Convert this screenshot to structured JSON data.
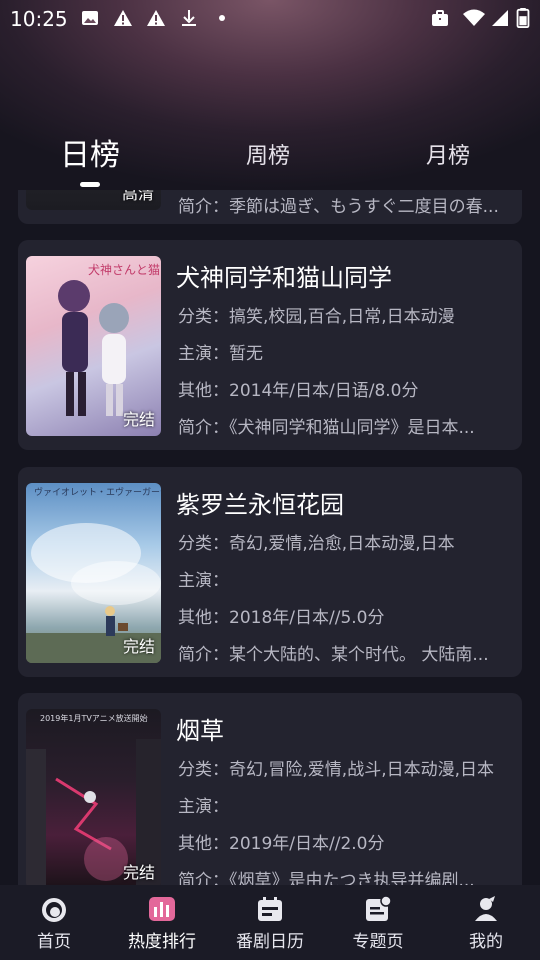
{
  "status_bar": {
    "time": "10:25",
    "left_icons": [
      "image-icon",
      "warning-icon",
      "warning-icon",
      "download-icon",
      "dot-icon"
    ],
    "right_icons": [
      "briefcase-icon",
      "wifi-icon",
      "signal-icon",
      "battery-icon"
    ]
  },
  "tabs": [
    {
      "label": "日榜",
      "active": true
    },
    {
      "label": "周榜",
      "active": false
    },
    {
      "label": "月榜",
      "active": false
    }
  ],
  "partial_card": {
    "badge": "高清",
    "summary": "简介：季節は過ぎ、もうすぐ二度目の春..."
  },
  "cards": [
    {
      "title": "犬神同学和猫山同学",
      "category": "分类：搞笑,校园,百合,日常,日本动漫",
      "cast": "主演：暂无",
      "other": "其他：2014年/日本/日语/8.0分",
      "summary": "简介：《犬神同学和猫山同学》是日本...",
      "badge": "完结"
    },
    {
      "title": "紫罗兰永恒花园",
      "category": "分类：奇幻,爱情,治愈,日本动漫,日本",
      "cast": "主演：",
      "other": "其他：2018年/日本//5.0分",
      "summary": "简介：某个大陆的、某个时代。 大陆南...",
      "badge": "完结"
    },
    {
      "title": "烟草",
      "category": "分类：奇幻,冒险,爱情,战斗,日本动漫,日本",
      "cast": "主演：",
      "other": "其他：2019年/日本//2.0分",
      "summary": "简介：《烟草》是由たつき执导并编剧...",
      "badge": "完结"
    }
  ],
  "bottom_nav": [
    {
      "label": "首页",
      "icon": "home-icon",
      "active": false
    },
    {
      "label": "热度排行",
      "icon": "ranking-icon",
      "active": true
    },
    {
      "label": "番剧日历",
      "icon": "calendar-icon",
      "active": false
    },
    {
      "label": "专题页",
      "icon": "topic-icon",
      "active": false
    },
    {
      "label": "我的",
      "icon": "profile-icon",
      "active": false
    }
  ],
  "colors": {
    "background": "#15151f",
    "card": "#23232f",
    "nav_background": "#1b1b26",
    "accent_pink": "#e3689a"
  }
}
